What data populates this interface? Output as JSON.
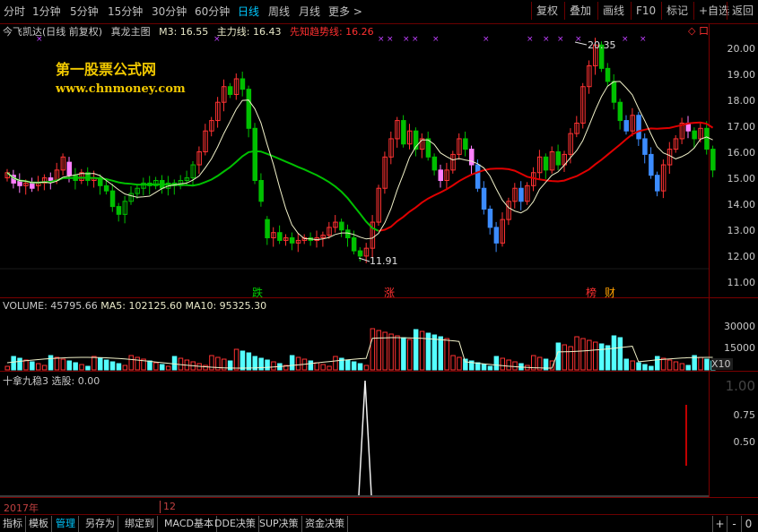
{
  "toolbar": {
    "periods": [
      "分时",
      "1分钟",
      "5分钟",
      "15分钟",
      "30分钟",
      "60分钟",
      "日线",
      "周线",
      "月线",
      "更多"
    ],
    "more_arrow": ">",
    "active_period": "日线",
    "buttons": [
      "复权",
      "叠加",
      "画线",
      "F10",
      "标记",
      "+自选",
      "返回"
    ]
  },
  "info": {
    "stock": "今飞凯达(日线 前复权)",
    "indicator": "真龙主图",
    "m3": "M3: 16.55",
    "main_line": "主力线: 16.43",
    "trend_line": "先知趋势线: 16.26"
  },
  "watermark": {
    "title": "第一股票公式网",
    "url": "www.chnmoney.com"
  },
  "main_chart": {
    "price_axis": [
      "20.00",
      "19.00",
      "18.00",
      "17.00",
      "16.00",
      "15.00",
      "14.00",
      "13.00",
      "12.00",
      "11.00"
    ],
    "high_label": "20.35",
    "low_label": "11.91",
    "markers": [
      "跌",
      "涨",
      "榜",
      "财"
    ],
    "corner_icons": "◇ 口"
  },
  "volume": {
    "title": "VOLUME: 45795.66",
    "ma5": "MA5: 102125.60",
    "ma10": "MA10: 95325.30",
    "axis": [
      "30000",
      "15000"
    ],
    "unit": "X10"
  },
  "indicator_pane": {
    "title": "十拿九稳3",
    "signal": "选股: 0.00",
    "axis": [
      "1.00",
      "0.75",
      "0.50"
    ],
    "date_left": "2017年",
    "date_mid": "12"
  },
  "bottom_tabs": [
    "指标",
    "模板",
    "管理",
    "另存为",
    "绑定到",
    "MACD基本",
    "DDE决策",
    "SUP决策",
    "资金决策"
  ],
  "active_tab": "管理",
  "bottom_controls": [
    "+",
    "-",
    "0"
  ],
  "colors": {
    "up": "#ff3232",
    "down": "#54ffff",
    "green": "#00c000",
    "pink": "#ff80ff",
    "blue": "#3c8cff",
    "trend_red": "#e00000",
    "ma_white": "#f0f0c8",
    "border": "#7a0000"
  }
}
